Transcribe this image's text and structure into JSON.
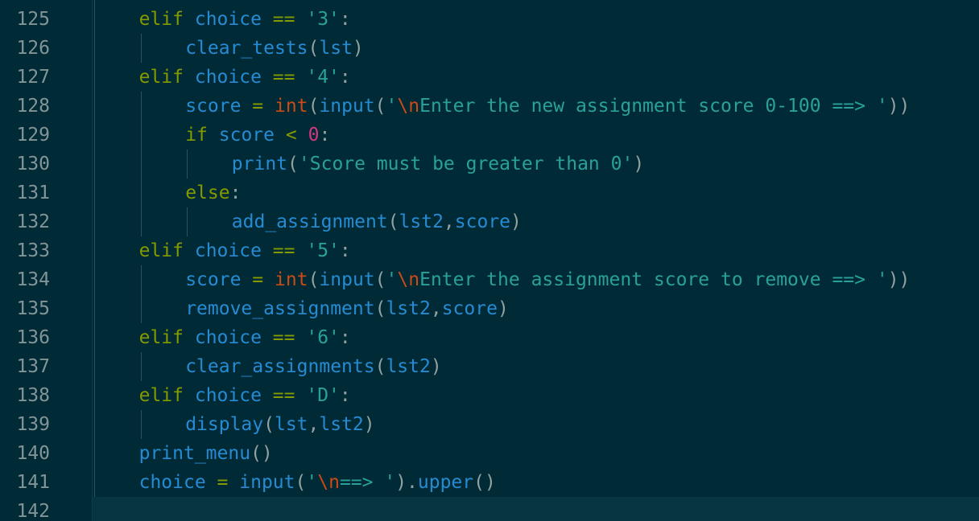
{
  "editor": {
    "colors": {
      "background": "#002b36",
      "current_line": "#073642",
      "keyword": "#859900",
      "identifier": "#268bd2",
      "string": "#2aa198",
      "escape": "#cb4b16",
      "number": "#d33682",
      "line_number": "#839496"
    },
    "lines": [
      {
        "n": "125",
        "indent": 1,
        "tokens": [
          [
            "kw",
            "elif"
          ],
          [
            "p",
            " "
          ],
          [
            "id",
            "choice"
          ],
          [
            "p",
            " "
          ],
          [
            "op",
            "=="
          ],
          [
            "p",
            " "
          ],
          [
            "str",
            "'3'"
          ],
          [
            "p",
            ":"
          ]
        ]
      },
      {
        "n": "126",
        "indent": 2,
        "tokens": [
          [
            "id",
            "clear_tests"
          ],
          [
            "p",
            "("
          ],
          [
            "id",
            "lst"
          ],
          [
            "p",
            ")"
          ]
        ]
      },
      {
        "n": "127",
        "indent": 1,
        "tokens": [
          [
            "kw",
            "elif"
          ],
          [
            "p",
            " "
          ],
          [
            "id",
            "choice"
          ],
          [
            "p",
            " "
          ],
          [
            "op",
            "=="
          ],
          [
            "p",
            " "
          ],
          [
            "str",
            "'4'"
          ],
          [
            "p",
            ":"
          ]
        ]
      },
      {
        "n": "128",
        "indent": 2,
        "tokens": [
          [
            "id",
            "score"
          ],
          [
            "p",
            " "
          ],
          [
            "op",
            "="
          ],
          [
            "p",
            " "
          ],
          [
            "bi",
            "int"
          ],
          [
            "p",
            "("
          ],
          [
            "id",
            "input"
          ],
          [
            "p",
            "("
          ],
          [
            "str",
            "'"
          ],
          [
            "esc",
            "\\n"
          ],
          [
            "str",
            "Enter the new assignment score 0-100 ==> '"
          ],
          [
            "p",
            "))"
          ]
        ]
      },
      {
        "n": "129",
        "indent": 2,
        "tokens": [
          [
            "kw",
            "if"
          ],
          [
            "p",
            " "
          ],
          [
            "id",
            "score"
          ],
          [
            "p",
            " "
          ],
          [
            "op",
            "<"
          ],
          [
            "p",
            " "
          ],
          [
            "num",
            "0"
          ],
          [
            "p",
            ":"
          ]
        ]
      },
      {
        "n": "130",
        "indent": 3,
        "tokens": [
          [
            "id",
            "print"
          ],
          [
            "p",
            "("
          ],
          [
            "str",
            "'Score must be greater than 0'"
          ],
          [
            "p",
            ")"
          ]
        ]
      },
      {
        "n": "131",
        "indent": 2,
        "tokens": [
          [
            "kw",
            "else"
          ],
          [
            "p",
            ":"
          ]
        ]
      },
      {
        "n": "132",
        "indent": 3,
        "tokens": [
          [
            "id",
            "add_assignment"
          ],
          [
            "p",
            "("
          ],
          [
            "id",
            "lst2"
          ],
          [
            "p",
            ","
          ],
          [
            "id",
            "score"
          ],
          [
            "p",
            ")"
          ]
        ]
      },
      {
        "n": "133",
        "indent": 1,
        "tokens": [
          [
            "kw",
            "elif"
          ],
          [
            "p",
            " "
          ],
          [
            "id",
            "choice"
          ],
          [
            "p",
            " "
          ],
          [
            "op",
            "=="
          ],
          [
            "p",
            " "
          ],
          [
            "str",
            "'5'"
          ],
          [
            "p",
            ":"
          ]
        ]
      },
      {
        "n": "134",
        "indent": 2,
        "tokens": [
          [
            "id",
            "score"
          ],
          [
            "p",
            " "
          ],
          [
            "op",
            "="
          ],
          [
            "p",
            " "
          ],
          [
            "bi",
            "int"
          ],
          [
            "p",
            "("
          ],
          [
            "id",
            "input"
          ],
          [
            "p",
            "("
          ],
          [
            "str",
            "'"
          ],
          [
            "esc",
            "\\n"
          ],
          [
            "str",
            "Enter the assignment score to remove ==> '"
          ],
          [
            "p",
            "))"
          ]
        ]
      },
      {
        "n": "135",
        "indent": 2,
        "tokens": [
          [
            "id",
            "remove_assignment"
          ],
          [
            "p",
            "("
          ],
          [
            "id",
            "lst2"
          ],
          [
            "p",
            ","
          ],
          [
            "id",
            "score"
          ],
          [
            "p",
            ")"
          ]
        ]
      },
      {
        "n": "136",
        "indent": 1,
        "tokens": [
          [
            "kw",
            "elif"
          ],
          [
            "p",
            " "
          ],
          [
            "id",
            "choice"
          ],
          [
            "p",
            " "
          ],
          [
            "op",
            "=="
          ],
          [
            "p",
            " "
          ],
          [
            "str",
            "'6'"
          ],
          [
            "p",
            ":"
          ]
        ]
      },
      {
        "n": "137",
        "indent": 2,
        "tokens": [
          [
            "id",
            "clear_assignments"
          ],
          [
            "p",
            "("
          ],
          [
            "id",
            "lst2"
          ],
          [
            "p",
            ")"
          ]
        ]
      },
      {
        "n": "138",
        "indent": 1,
        "tokens": [
          [
            "kw",
            "elif"
          ],
          [
            "p",
            " "
          ],
          [
            "id",
            "choice"
          ],
          [
            "p",
            " "
          ],
          [
            "op",
            "=="
          ],
          [
            "p",
            " "
          ],
          [
            "str",
            "'D'"
          ],
          [
            "p",
            ":"
          ]
        ]
      },
      {
        "n": "139",
        "indent": 2,
        "tokens": [
          [
            "id",
            "display"
          ],
          [
            "p",
            "("
          ],
          [
            "id",
            "lst"
          ],
          [
            "p",
            ","
          ],
          [
            "id",
            "lst2"
          ],
          [
            "p",
            ")"
          ]
        ]
      },
      {
        "n": "140",
        "indent": 1,
        "tokens": [
          [
            "id",
            "print_menu"
          ],
          [
            "p",
            "()"
          ]
        ]
      },
      {
        "n": "141",
        "indent": 1,
        "tokens": [
          [
            "id",
            "choice"
          ],
          [
            "p",
            " "
          ],
          [
            "op",
            "="
          ],
          [
            "p",
            " "
          ],
          [
            "id",
            "input"
          ],
          [
            "p",
            "("
          ],
          [
            "str",
            "'"
          ],
          [
            "esc",
            "\\n"
          ],
          [
            "str",
            "==> '"
          ],
          [
            "p",
            ")."
          ],
          [
            "id",
            "upper"
          ],
          [
            "p",
            "()"
          ]
        ]
      },
      {
        "n": "142",
        "indent": 0,
        "tokens": []
      }
    ]
  }
}
